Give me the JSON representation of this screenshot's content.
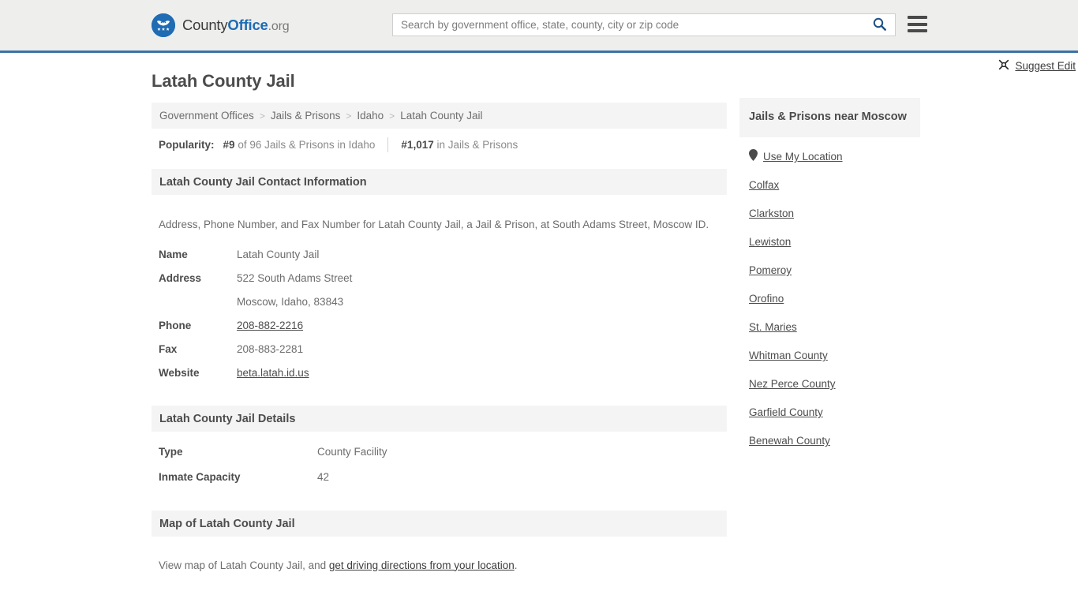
{
  "header": {
    "logo_name_part1": "County",
    "logo_name_part2": "Office",
    "logo_name_part3": ".org",
    "logo_icon": "eagle-shield-logo",
    "search_placeholder": "Search by government office, state, county, city or zip code",
    "search_value": "",
    "search_icon": "search-icon",
    "menu_icon": "hamburger-menu-icon"
  },
  "page": {
    "title": "Latah County Jail"
  },
  "breadcrumb": {
    "separator": ">",
    "items": [
      {
        "label": "Government Offices",
        "current": false
      },
      {
        "label": "Jails & Prisons",
        "current": false
      },
      {
        "label": "Idaho",
        "current": false
      },
      {
        "label": "Latah County Jail",
        "current": true
      }
    ]
  },
  "popularity": {
    "label": "Popularity:",
    "state_rank": "#9",
    "state_text": "of 96 Jails & Prisons in Idaho",
    "national_rank": "#1,017",
    "national_text": "in Jails & Prisons"
  },
  "contact": {
    "section_title": "Latah County Jail Contact Information",
    "description": "Address, Phone Number, and Fax Number for Latah County Jail, a Jail & Prison, at South Adams Street, Moscow ID.",
    "suggest_edit_label": "Suggest Edit",
    "suggest_edit_icon": "edit-pencil-icon",
    "rows": [
      {
        "key": "Name",
        "value": "Latah County Jail",
        "link": false
      },
      {
        "key": "Address",
        "value": "522 South Adams Street",
        "link": false
      },
      {
        "key": "",
        "value": "Moscow, Idaho, 83843",
        "link": false
      },
      {
        "key": "Phone",
        "value": "208-882-2216",
        "link": true
      },
      {
        "key": "Fax",
        "value": "208-883-2281",
        "link": false
      },
      {
        "key": "Website",
        "value": "beta.latah.id.us",
        "link": true
      }
    ]
  },
  "details": {
    "section_title": "Latah County Jail Details",
    "rows": [
      {
        "key": "Type",
        "value": "County Facility"
      },
      {
        "key": "Inmate Capacity",
        "value": "42"
      }
    ]
  },
  "map": {
    "section_title": "Map of Latah County Jail",
    "text_before": "View map of Latah County Jail, and ",
    "link_text": "get driving directions from your location",
    "text_after": "."
  },
  "sidebar": {
    "title": "Jails & Prisons near Moscow",
    "location_icon": "map-pin-icon",
    "items": [
      {
        "label": "Use My Location",
        "icon": "map-pin-icon"
      },
      {
        "label": "Colfax",
        "icon": ""
      },
      {
        "label": "Clarkston",
        "icon": ""
      },
      {
        "label": "Lewiston",
        "icon": ""
      },
      {
        "label": "Pomeroy",
        "icon": ""
      },
      {
        "label": "Orofino",
        "icon": ""
      },
      {
        "label": "St. Maries",
        "icon": ""
      },
      {
        "label": "Whitman County",
        "icon": ""
      },
      {
        "label": "Nez Perce County",
        "icon": ""
      },
      {
        "label": "Garfield County",
        "icon": ""
      },
      {
        "label": "Benewah County",
        "icon": ""
      }
    ]
  },
  "colors": {
    "brand_blue": "#1f6bb4",
    "header_bg": "#eeeeed",
    "header_border": "#3b72a5",
    "section_bg": "#f4f4f4",
    "text_dark": "#4c4c4c",
    "text_muted": "#6d6d6d"
  }
}
